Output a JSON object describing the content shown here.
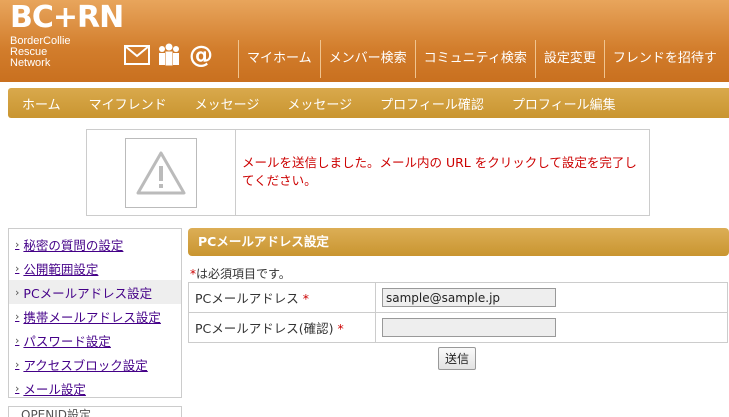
{
  "brand": {
    "logo": "BC+RN",
    "subtitle_lines": [
      "BorderCollie",
      "Rescue",
      "Network"
    ]
  },
  "header_icons": [
    "mail-icon",
    "members-icon",
    "at-icon"
  ],
  "topnav": [
    "マイホーム",
    "メンバー検索",
    "コミュニティ検索",
    "設定変更",
    "フレンドを招待す"
  ],
  "subnav": [
    "ホーム",
    "マイフレンド",
    "メッセージ",
    "メッセージ",
    "プロフィール確認",
    "プロフィール編集"
  ],
  "notice": {
    "icon": "warning-icon",
    "message": "メールを送信しました。メール内の URL をクリックして設定を完了してください。"
  },
  "sidebar": {
    "items": [
      {
        "label": "秘密の質問の設定",
        "active": false
      },
      {
        "label": "公開範囲設定",
        "active": false
      },
      {
        "label": "PCメールアドレス設定",
        "active": true
      },
      {
        "label": "携帯メールアドレス設定",
        "active": false
      },
      {
        "label": "パスワード設定",
        "active": false
      },
      {
        "label": "アクセスブロック設定",
        "active": false
      },
      {
        "label": "メール設定",
        "active": false
      }
    ],
    "next_box_text": "OPENID設定"
  },
  "main": {
    "title": "PCメールアドレス設定",
    "required_mark": "*",
    "required_note": "は必須項目です。",
    "fields": [
      {
        "label": "PCメールアドレス",
        "required": "*",
        "value": "sample@sample.jp"
      },
      {
        "label": "PCメールアドレス(確認)",
        "required": "*",
        "value": ""
      }
    ],
    "submit_label": "送信"
  }
}
